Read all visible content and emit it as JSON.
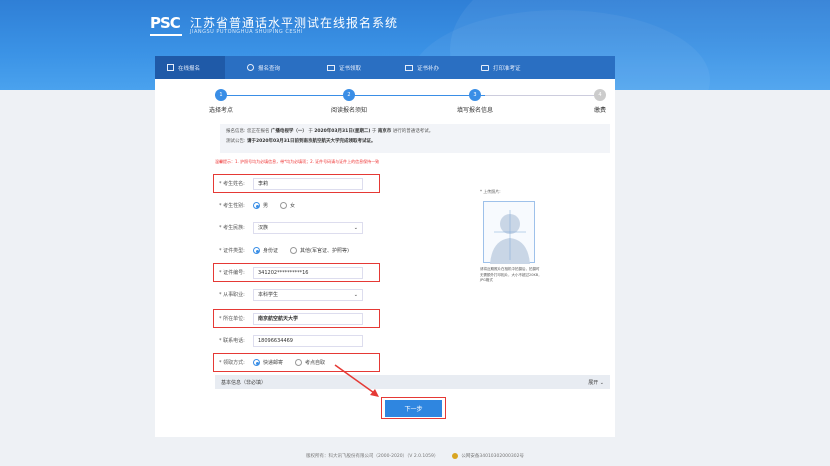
{
  "header": {
    "logo": "PSC",
    "title_cn": "江苏省普通话水平测试在线报名系统",
    "title_en": "JIANGSU PUTONGHUA SHUIPING CESHI"
  },
  "nav": {
    "items": [
      {
        "label": "在线报名",
        "icon": "edit-icon"
      },
      {
        "label": "报名查询",
        "icon": "search-icon"
      },
      {
        "label": "证书领取",
        "icon": "certificate-icon"
      },
      {
        "label": "证书补办",
        "icon": "certificate-reissue-icon"
      },
      {
        "label": "打印准考证",
        "icon": "printer-icon"
      }
    ],
    "active_index": 0
  },
  "steps": [
    {
      "num": "1",
      "label": "选择考点"
    },
    {
      "num": "2",
      "label": "阅读报名须知"
    },
    {
      "num": "3",
      "label": "填写报名信息"
    },
    {
      "num": "4",
      "label": "缴费"
    }
  ],
  "info": {
    "line1_prefix": "报名信息: 您正在报名",
    "line1_test": "广播电视学（一）",
    "line1_mid": "于",
    "line1_date": "2020年03月31日(星期二)",
    "line1_mid2": "于",
    "line1_city": "南京市",
    "line1_suffix": "进行的普通话考试。",
    "line2_prefix": "测试公告:",
    "line2_text": "请于2020年03月31日前到南京航空航天大学完成领取考试证。"
  },
  "warning": "温馨提示：1. 护照号均为必填信息，带*均为必填项；2. 证件号码请与证件上的信息保持一致",
  "form": {
    "name_label": "* 考生姓名:",
    "name_value": "李莉",
    "gender_label": "* 考生性别:",
    "gender_options": [
      "男",
      "女"
    ],
    "gender_selected": "男",
    "ethnicity_label": "* 考生民族:",
    "ethnicity_value": "汉族",
    "id_type_label": "* 证件类型:",
    "id_type_options": [
      "身份证",
      "其他(军官证、护照等)"
    ],
    "id_type_selected": "身份证",
    "id_number_label": "* 证件编号:",
    "id_number_value": "341202**********16",
    "occupation_label": "* 从事职业:",
    "occupation_value": "本科学生",
    "unit_label": "* 所在单位:",
    "unit_value": "南京航空航天大学",
    "phone_label": "* 联系电话:",
    "phone_value": "18096634469",
    "pickup_label": "* 领取方式:",
    "pickup_options": [
      "快递邮寄",
      "考点自取"
    ],
    "pickup_selected": "快递邮寄"
  },
  "photo": {
    "label": "* 上传照片:",
    "tip": "请将近期照片在相机中拍摄后，拍摄时无需额外打印相片，大小不超过20KB，JPG格式"
  },
  "basic_info": {
    "label": "基本信息（非必填）",
    "expand": "展开"
  },
  "next_button": "下一步",
  "footer": {
    "copyright": "版权所有：科大讯飞股份有限公司（2000-2020）（V 2.0.1059）",
    "police": "公网安备34010302000302号"
  },
  "colors": {
    "primary": "#3a8ee6",
    "nav_bg": "#2a6fc2",
    "highlight": "#e53935"
  }
}
